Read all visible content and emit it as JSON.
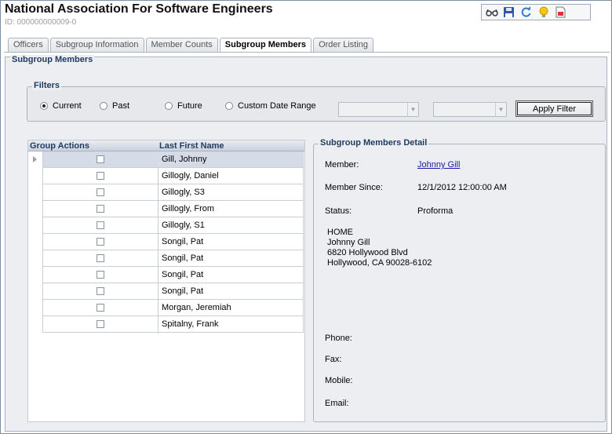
{
  "header": {
    "title": "National Association For Software Engineers",
    "id_label": "ID: 000000000009-0"
  },
  "toolbar": {
    "icons": [
      "glasses-icon",
      "save-icon",
      "refresh-icon",
      "lightbulb-icon",
      "report-icon"
    ]
  },
  "tabs": [
    {
      "label": "Officers",
      "active": false
    },
    {
      "label": "Subgroup Information",
      "active": false
    },
    {
      "label": "Member Counts",
      "active": false
    },
    {
      "label": "Subgroup Members",
      "active": true
    },
    {
      "label": "Order Listing",
      "active": false
    }
  ],
  "panel": {
    "title": "Subgroup Members"
  },
  "filters": {
    "title": "Filters",
    "options": [
      {
        "label": "Current",
        "selected": true
      },
      {
        "label": "Past",
        "selected": false
      },
      {
        "label": "Future",
        "selected": false
      },
      {
        "label": "Custom Date Range",
        "selected": false
      }
    ],
    "date_from": "",
    "date_to": "",
    "apply_label": "Apply Filter"
  },
  "grid": {
    "col_actions": "Group Actions",
    "col_name": "Last First Name",
    "selected_row": 0,
    "rows": [
      "Gill, Johnny",
      "Gillogly, Daniel",
      "Gillogly, S3",
      "Gillogly, From",
      "Gillogly, S1",
      "Songil, Pat",
      "Songil, Pat",
      "Songil, Pat",
      "Songil, Pat",
      "Morgan, Jeremiah",
      "Spitalny, Frank"
    ]
  },
  "detail": {
    "title": "Subgroup Members Detail",
    "member_label": "Member:",
    "member_value": "Johnny Gill",
    "since_label": "Member Since:",
    "since_value": "12/1/2012 12:00:00 AM",
    "status_label": "Status:",
    "status_value": "Proforma",
    "address": {
      "type": "HOME",
      "name": "Johnny Gill",
      "street": "6820 Hollywood Blvd",
      "city": "Hollywood, CA 90028-6102"
    },
    "phone_label": "Phone:",
    "fax_label": "Fax:",
    "mobile_label": "Mobile:",
    "email_label": "Email:"
  },
  "colors": {
    "accent": "#1f3a5f",
    "link": "#1a1aa6",
    "selected_row": "#d5dce8"
  }
}
